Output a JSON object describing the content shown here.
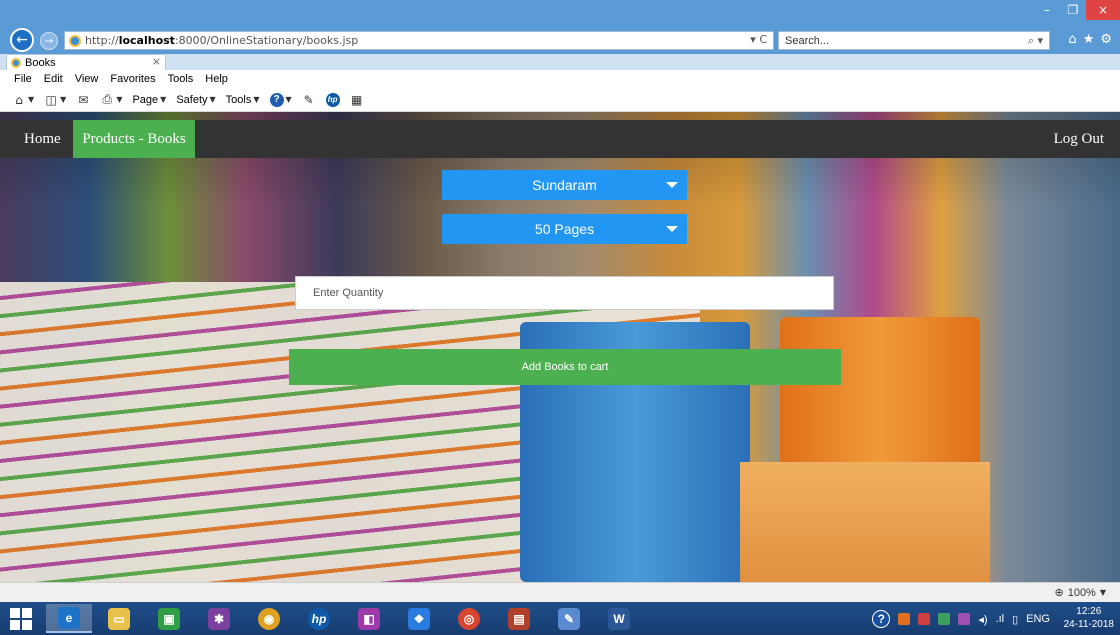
{
  "browser": {
    "url_prefix": "http://",
    "url_host": "localhost",
    "url_rest": ":8000/OnlineStationary/books.jsp",
    "address_tools": "▾ C",
    "search_placeholder": "Search...",
    "tab_title": "Books",
    "tab_close": "×",
    "menu": [
      "File",
      "Edit",
      "View",
      "Favorites",
      "Tools",
      "Help"
    ],
    "command_bar": [
      "Page",
      "Safety",
      "Tools"
    ],
    "window_controls": [
      "–",
      "❐",
      "×"
    ]
  },
  "page": {
    "nav": {
      "home": "Home",
      "active": "Products - Books",
      "logout": "Log Out"
    },
    "brand_select": {
      "selected": "Sundaram"
    },
    "pages_select": {
      "selected": "50 Pages"
    },
    "quantity_input": {
      "placeholder": "Enter Quantity",
      "value": ""
    },
    "add_button": "Add Books to cart"
  },
  "statusbar": {
    "zoom": "100%"
  },
  "taskbar": {
    "time": "12:26",
    "date": "24-11-2018",
    "language": "ENG"
  },
  "colors": {
    "navbar": "#333333",
    "nav_active": "#4caf50",
    "select_bg": "#2196f3",
    "button_bg": "#4caf50"
  }
}
